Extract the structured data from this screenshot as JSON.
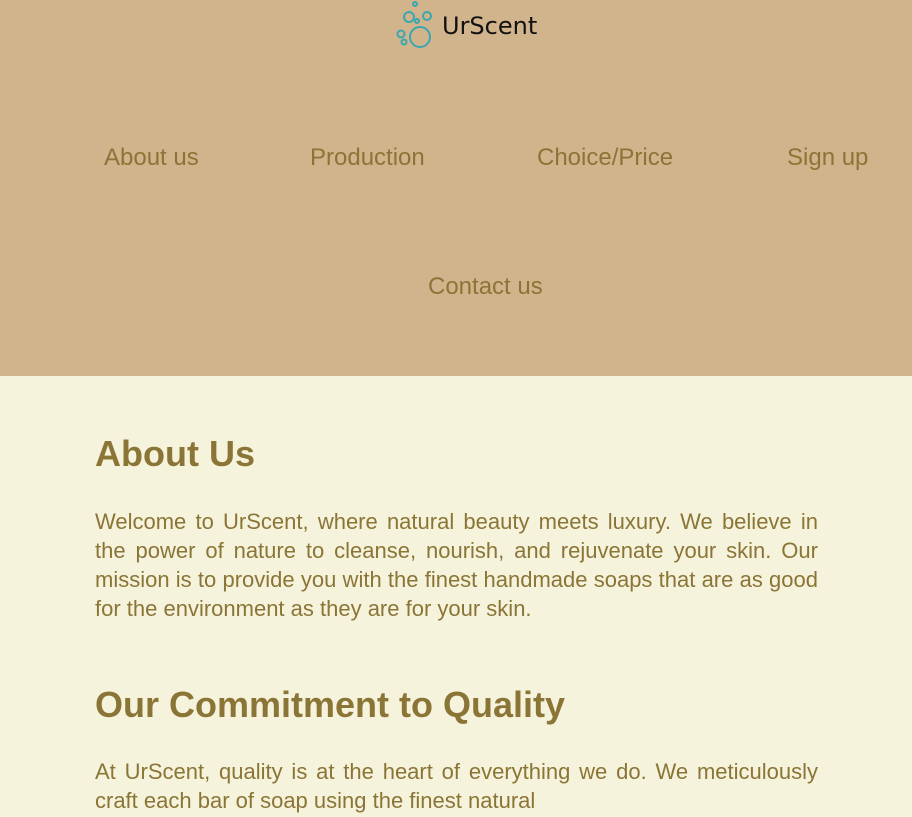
{
  "brand": {
    "name": "UrScent",
    "logo_icon": "bubbles-icon",
    "logo_color": "#3aa7b0"
  },
  "nav": {
    "items": [
      {
        "label": "About us"
      },
      {
        "label": "Production"
      },
      {
        "label": "Choice/Price"
      },
      {
        "label": "Sign up"
      },
      {
        "label": "Contact us"
      }
    ]
  },
  "colors": {
    "header_bg": "#d1b48c",
    "page_bg": "#f5f3dc",
    "text": "#8b7536"
  },
  "main": {
    "sections": [
      {
        "heading": "About Us",
        "body": "Welcome to UrScent, where natural beauty meets luxury. We believe in the power of nature to cleanse, nourish, and rejuvenate your skin. Our mission is to provide you with the finest handmade soaps that are as good for the environment as they are for your skin."
      },
      {
        "heading": "Our Commitment to Quality",
        "body": "At UrScent, quality is at the heart of everything we do. We meticulously craft each bar of soap using the finest natural"
      }
    ]
  }
}
